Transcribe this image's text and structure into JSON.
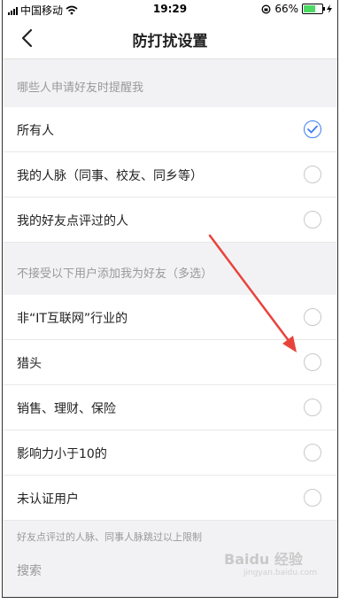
{
  "statusbar": {
    "carrier": "中国移动",
    "time": "19:29",
    "battery": "66%",
    "battery_level": 0.66
  },
  "nav": {
    "title": "防打扰设置"
  },
  "sections": {
    "remind_header": "哪些人申请好友时提醒我",
    "remind_options": [
      {
        "label": "所有人",
        "checked": true
      },
      {
        "label": "我的人脉（同事、校友、同乡等）",
        "checked": false
      },
      {
        "label": "我的好友点评过的人",
        "checked": false
      }
    ],
    "block_header": "不接受以下用户添加我为好友（多选）",
    "block_options": [
      {
        "label": "非“IT互联网”行业的",
        "checked": false
      },
      {
        "label": "猎头",
        "checked": false
      },
      {
        "label": "销售、理财、保险",
        "checked": false
      },
      {
        "label": "影响力小于10的",
        "checked": false
      },
      {
        "label": "未认证用户",
        "checked": false
      }
    ],
    "footer_note": "好友点评过的人脉、同事人脉跳过以上限制"
  },
  "search": {
    "label": "搜索"
  },
  "watermark": {
    "brand": "Baidu 经验",
    "url": "jingyan.baidu.com"
  },
  "colors": {
    "accent": "#3d7ef0",
    "annotation": "#e8433b"
  }
}
